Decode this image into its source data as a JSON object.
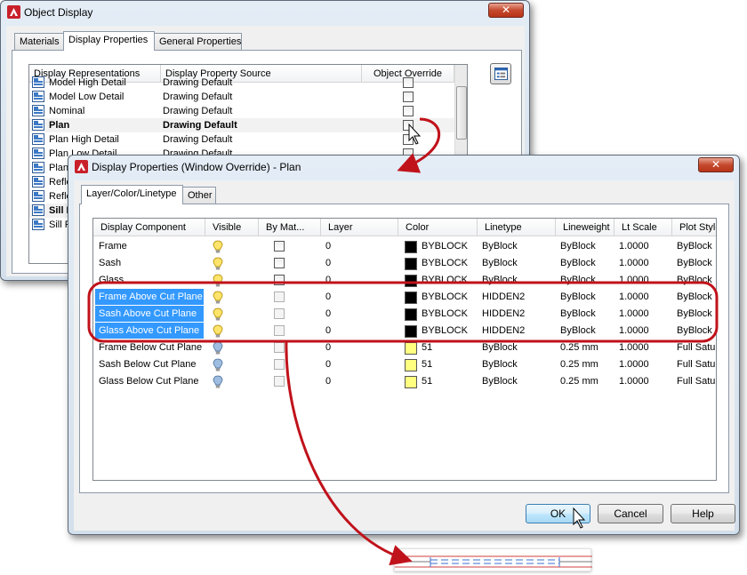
{
  "back_window": {
    "title": "Object Display",
    "close_glyph": "✕",
    "tabs": [
      "Materials",
      "Display Properties",
      "General Properties"
    ],
    "columns": [
      "Display Representations",
      "Display Property Source",
      "Object Override"
    ],
    "rows": [
      {
        "name": "Model High Detail",
        "source": "Drawing Default",
        "bold": false
      },
      {
        "name": "Model Low Detail",
        "source": "Drawing Default",
        "bold": false
      },
      {
        "name": "Nominal",
        "source": "Drawing Default",
        "bold": false
      },
      {
        "name": "Plan",
        "source": "Drawing Default",
        "bold": true
      },
      {
        "name": "Plan High Detail",
        "source": "Drawing Default",
        "bold": false
      },
      {
        "name": "Plan Low Detail",
        "source": "Drawing Default",
        "bold": false
      },
      {
        "name": "Plan",
        "source": "",
        "bold": false
      },
      {
        "name": "Refle",
        "source": "",
        "bold": false
      },
      {
        "name": "Refle",
        "source": "",
        "bold": false
      },
      {
        "name": "Sill P",
        "source": "",
        "bold": true
      },
      {
        "name": "Sill P",
        "source": "",
        "bold": false
      }
    ]
  },
  "front_window": {
    "title": "Display Properties (Window Override) - Plan",
    "close_glyph": "✕",
    "tabs": [
      "Layer/Color/Linetype",
      "Other"
    ],
    "columns": [
      "Display Component",
      "Visible",
      "By Mat...",
      "Layer",
      "Color",
      "Linetype",
      "Lineweight",
      "Lt Scale",
      "Plot Style"
    ],
    "rows": [
      {
        "component": "Frame",
        "visible": true,
        "layer": "0",
        "color_hex": "#000000",
        "color": "BYBLOCK",
        "linetype": "ByBlock",
        "lineweight": "ByBlock",
        "ltscale": "1.0000",
        "plotstyle": "ByBlock",
        "selected": false
      },
      {
        "component": "Sash",
        "visible": true,
        "layer": "0",
        "color_hex": "#000000",
        "color": "BYBLOCK",
        "linetype": "ByBlock",
        "lineweight": "ByBlock",
        "ltscale": "1.0000",
        "plotstyle": "ByBlock",
        "selected": false
      },
      {
        "component": "Glass",
        "visible": true,
        "layer": "0",
        "color_hex": "#000000",
        "color": "BYBLOCK",
        "linetype": "ByBlock",
        "lineweight": "ByBlock",
        "ltscale": "1.0000",
        "plotstyle": "ByBlock",
        "selected": false
      },
      {
        "component": "Frame Above Cut Plane",
        "visible": true,
        "layer": "0",
        "color_hex": "#000000",
        "color": "BYBLOCK",
        "linetype": "HIDDEN2",
        "lineweight": "ByBlock",
        "ltscale": "1.0000",
        "plotstyle": "ByBlock",
        "selected": true
      },
      {
        "component": "Sash Above Cut Plane",
        "visible": true,
        "layer": "0",
        "color_hex": "#000000",
        "color": "BYBLOCK",
        "linetype": "HIDDEN2",
        "lineweight": "ByBlock",
        "ltscale": "1.0000",
        "plotstyle": "ByBlock",
        "selected": true
      },
      {
        "component": "Glass Above Cut Plane",
        "visible": true,
        "layer": "0",
        "color_hex": "#000000",
        "color": "BYBLOCK",
        "linetype": "HIDDEN2",
        "lineweight": "ByBlock",
        "ltscale": "1.0000",
        "plotstyle": "ByBlock",
        "selected": true
      },
      {
        "component": "Frame Below Cut Plane",
        "visible": false,
        "layer": "0",
        "color_hex": "#ffff80",
        "color": "51",
        "linetype": "ByBlock",
        "lineweight": "0.25 mm",
        "ltscale": "1.0000",
        "plotstyle": "Full Saturat...",
        "selected": false
      },
      {
        "component": "Sash Below Cut Plane",
        "visible": false,
        "layer": "0",
        "color_hex": "#ffff80",
        "color": "51",
        "linetype": "ByBlock",
        "lineweight": "0.25 mm",
        "ltscale": "1.0000",
        "plotstyle": "Full Saturat...",
        "selected": false
      },
      {
        "component": "Glass Below Cut Plane",
        "visible": false,
        "layer": "0",
        "color_hex": "#ffff80",
        "color": "51",
        "linetype": "ByBlock",
        "lineweight": "0.25 mm",
        "ltscale": "1.0000",
        "plotstyle": "Full Saturat...",
        "selected": false
      }
    ],
    "buttons": {
      "ok": "OK",
      "cancel": "Cancel",
      "help": "Help"
    }
  },
  "colors": {
    "annotation_red": "#c0121b",
    "selection_blue": "#3399ff",
    "bulb_on": "#ffe46b",
    "bulb_off": "#9fbde0"
  },
  "icons": {
    "app": "autocad-icon",
    "row": "display-rep-icon",
    "browse": "browse-icon",
    "bulb": "lightbulb-icon",
    "cursor": "mouse-pointer-icon"
  }
}
